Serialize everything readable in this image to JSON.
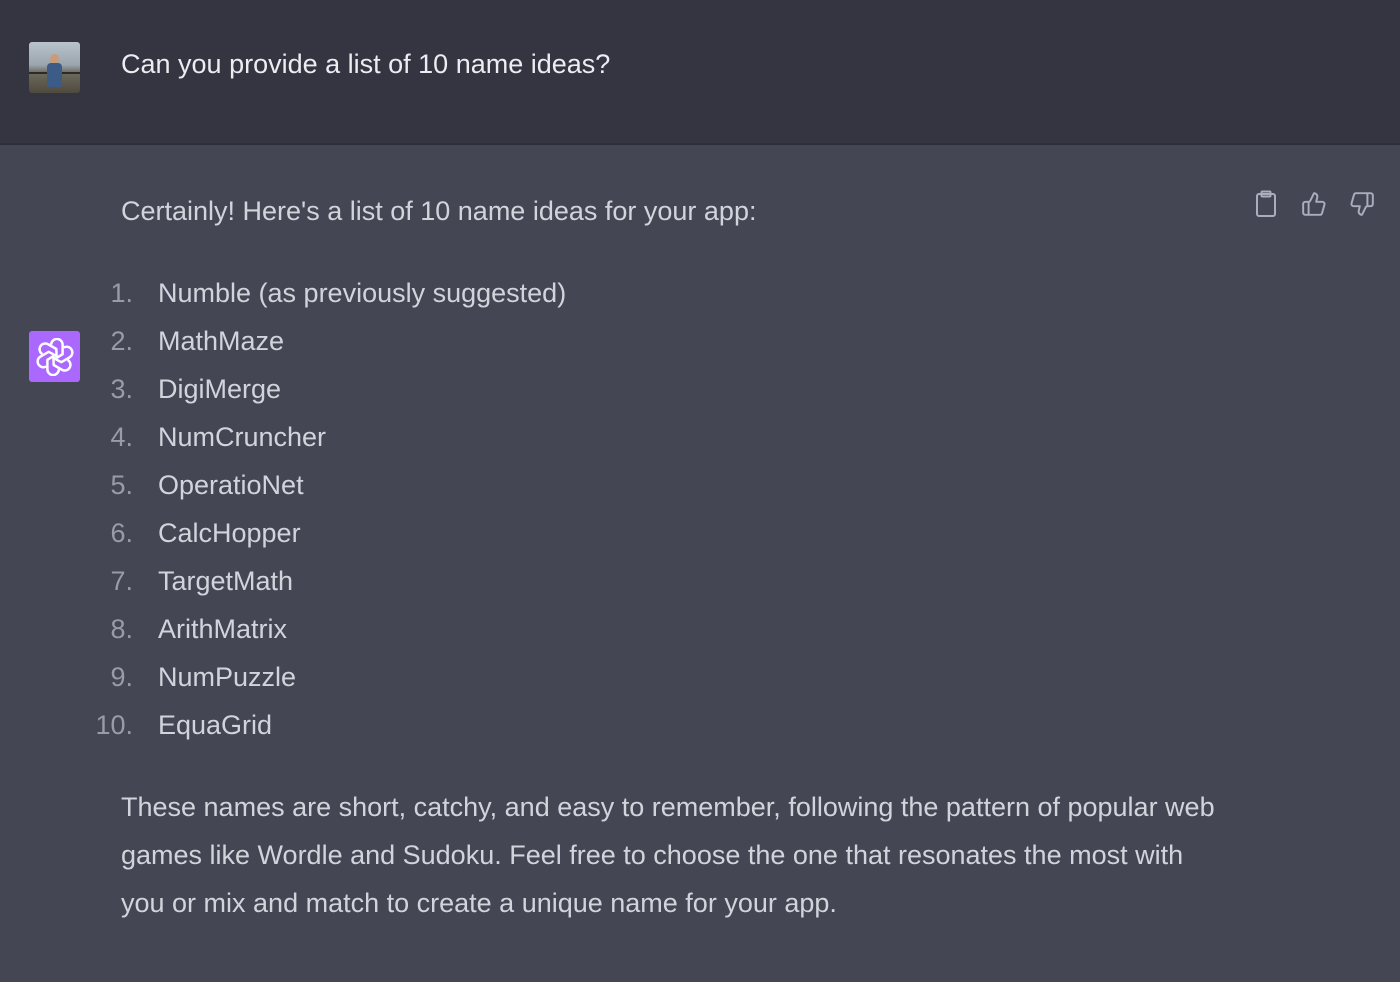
{
  "user_message": {
    "text": "Can you provide a list of 10 name ideas?"
  },
  "assistant_message": {
    "intro": "Certainly! Here's a list of 10 name ideas for your app:",
    "items": [
      {
        "num": "1.",
        "name": "Numble (as previously suggested)"
      },
      {
        "num": "2.",
        "name": "MathMaze"
      },
      {
        "num": "3.",
        "name": "DigiMerge"
      },
      {
        "num": "4.",
        "name": "NumCruncher"
      },
      {
        "num": "5.",
        "name": "OperatioNet"
      },
      {
        "num": "6.",
        "name": "CalcHopper"
      },
      {
        "num": "7.",
        "name": "TargetMath"
      },
      {
        "num": "8.",
        "name": "ArithMatrix"
      },
      {
        "num": "9.",
        "name": "NumPuzzle"
      },
      {
        "num": "10.",
        "name": "EquaGrid"
      }
    ],
    "outro": "These names are short, catchy, and easy to remember, following the pattern of popular web games like Wordle and Sudoku. Feel free to choose the one that resonates the most with you or mix and match to create a unique name for your app."
  },
  "icons": {
    "copy": "clipboard-icon",
    "like": "thumbs-up-icon",
    "dislike": "thumbs-down-icon",
    "assistant_logo": "openai-logo-icon"
  },
  "colors": {
    "user_bg": "#343541",
    "assistant_bg": "#444654",
    "assistant_avatar": "#ab68ff"
  }
}
